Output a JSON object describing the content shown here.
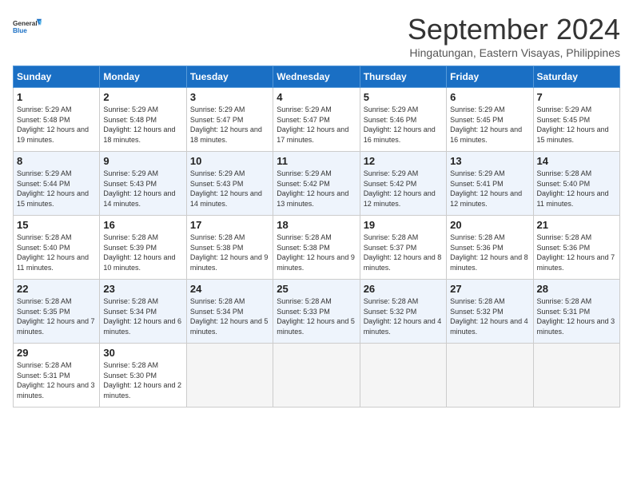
{
  "logo": {
    "line1": "General",
    "line2": "Blue"
  },
  "title": "September 2024",
  "location": "Hingatungan, Eastern Visayas, Philippines",
  "days_of_week": [
    "Sunday",
    "Monday",
    "Tuesday",
    "Wednesday",
    "Thursday",
    "Friday",
    "Saturday"
  ],
  "weeks": [
    [
      {
        "day": 1,
        "rise": "5:29 AM",
        "set": "5:48 PM",
        "daylight": "12 hours and 19 minutes."
      },
      {
        "day": 2,
        "rise": "5:29 AM",
        "set": "5:48 PM",
        "daylight": "12 hours and 18 minutes."
      },
      {
        "day": 3,
        "rise": "5:29 AM",
        "set": "5:47 PM",
        "daylight": "12 hours and 18 minutes."
      },
      {
        "day": 4,
        "rise": "5:29 AM",
        "set": "5:47 PM",
        "daylight": "12 hours and 17 minutes."
      },
      {
        "day": 5,
        "rise": "5:29 AM",
        "set": "5:46 PM",
        "daylight": "12 hours and 16 minutes."
      },
      {
        "day": 6,
        "rise": "5:29 AM",
        "set": "5:45 PM",
        "daylight": "12 hours and 16 minutes."
      },
      {
        "day": 7,
        "rise": "5:29 AM",
        "set": "5:45 PM",
        "daylight": "12 hours and 15 minutes."
      }
    ],
    [
      {
        "day": 8,
        "rise": "5:29 AM",
        "set": "5:44 PM",
        "daylight": "12 hours and 15 minutes."
      },
      {
        "day": 9,
        "rise": "5:29 AM",
        "set": "5:43 PM",
        "daylight": "12 hours and 14 minutes."
      },
      {
        "day": 10,
        "rise": "5:29 AM",
        "set": "5:43 PM",
        "daylight": "12 hours and 14 minutes."
      },
      {
        "day": 11,
        "rise": "5:29 AM",
        "set": "5:42 PM",
        "daylight": "12 hours and 13 minutes."
      },
      {
        "day": 12,
        "rise": "5:29 AM",
        "set": "5:42 PM",
        "daylight": "12 hours and 12 minutes."
      },
      {
        "day": 13,
        "rise": "5:29 AM",
        "set": "5:41 PM",
        "daylight": "12 hours and 12 minutes."
      },
      {
        "day": 14,
        "rise": "5:28 AM",
        "set": "5:40 PM",
        "daylight": "12 hours and 11 minutes."
      }
    ],
    [
      {
        "day": 15,
        "rise": "5:28 AM",
        "set": "5:40 PM",
        "daylight": "12 hours and 11 minutes."
      },
      {
        "day": 16,
        "rise": "5:28 AM",
        "set": "5:39 PM",
        "daylight": "12 hours and 10 minutes."
      },
      {
        "day": 17,
        "rise": "5:28 AM",
        "set": "5:38 PM",
        "daylight": "12 hours and 9 minutes."
      },
      {
        "day": 18,
        "rise": "5:28 AM",
        "set": "5:38 PM",
        "daylight": "12 hours and 9 minutes."
      },
      {
        "day": 19,
        "rise": "5:28 AM",
        "set": "5:37 PM",
        "daylight": "12 hours and 8 minutes."
      },
      {
        "day": 20,
        "rise": "5:28 AM",
        "set": "5:36 PM",
        "daylight": "12 hours and 8 minutes."
      },
      {
        "day": 21,
        "rise": "5:28 AM",
        "set": "5:36 PM",
        "daylight": "12 hours and 7 minutes."
      }
    ],
    [
      {
        "day": 22,
        "rise": "5:28 AM",
        "set": "5:35 PM",
        "daylight": "12 hours and 7 minutes."
      },
      {
        "day": 23,
        "rise": "5:28 AM",
        "set": "5:34 PM",
        "daylight": "12 hours and 6 minutes."
      },
      {
        "day": 24,
        "rise": "5:28 AM",
        "set": "5:34 PM",
        "daylight": "12 hours and 5 minutes."
      },
      {
        "day": 25,
        "rise": "5:28 AM",
        "set": "5:33 PM",
        "daylight": "12 hours and 5 minutes."
      },
      {
        "day": 26,
        "rise": "5:28 AM",
        "set": "5:32 PM",
        "daylight": "12 hours and 4 minutes."
      },
      {
        "day": 27,
        "rise": "5:28 AM",
        "set": "5:32 PM",
        "daylight": "12 hours and 4 minutes."
      },
      {
        "day": 28,
        "rise": "5:28 AM",
        "set": "5:31 PM",
        "daylight": "12 hours and 3 minutes."
      }
    ],
    [
      {
        "day": 29,
        "rise": "5:28 AM",
        "set": "5:31 PM",
        "daylight": "12 hours and 3 minutes."
      },
      {
        "day": 30,
        "rise": "5:28 AM",
        "set": "5:30 PM",
        "daylight": "12 hours and 2 minutes."
      },
      null,
      null,
      null,
      null,
      null
    ]
  ]
}
